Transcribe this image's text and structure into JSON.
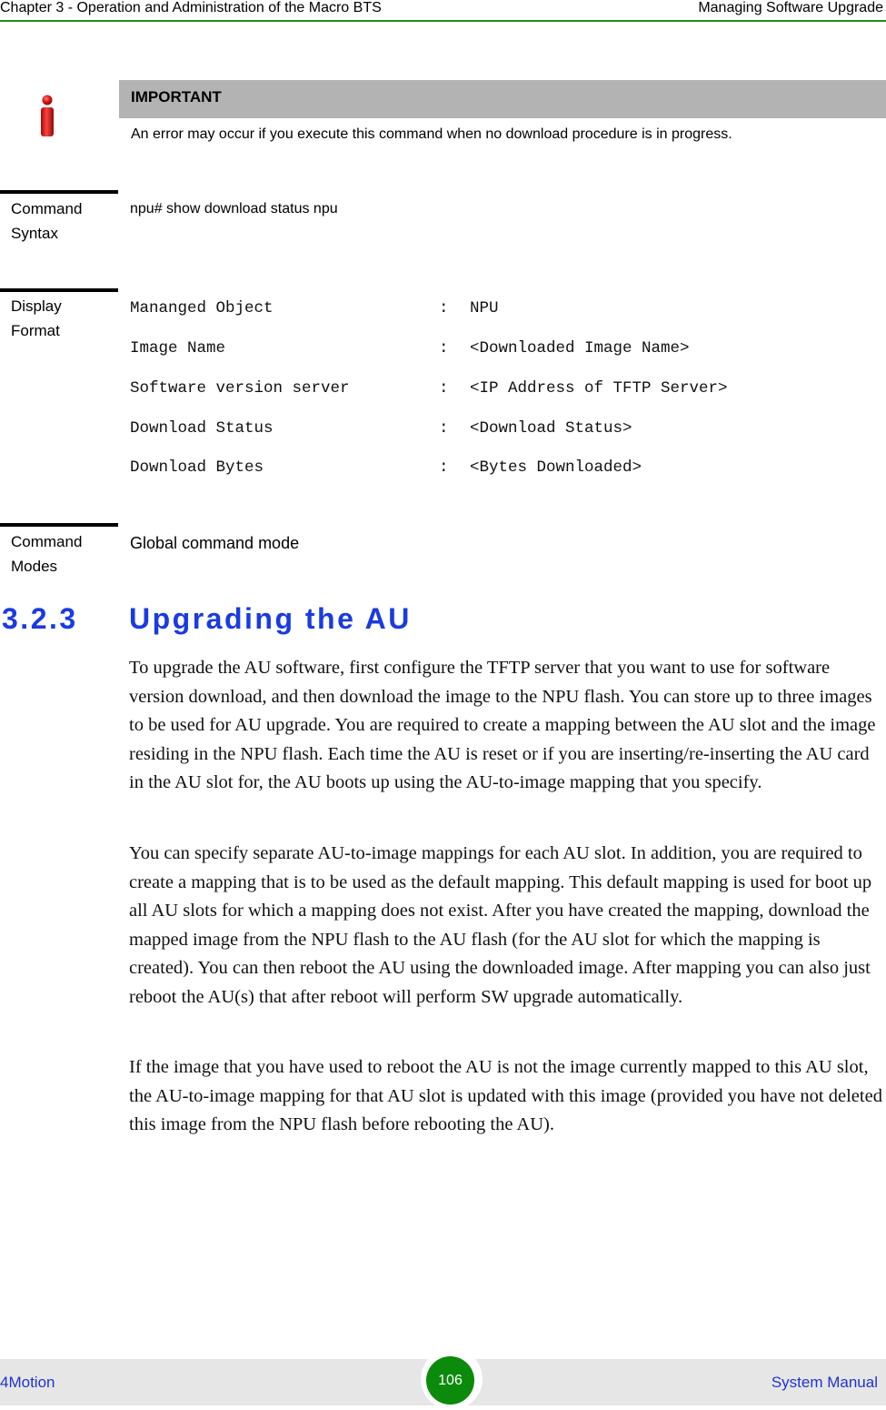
{
  "header": {
    "chapter": "Chapter 3 - Operation and Administration of the Macro BTS",
    "section": "Managing Software Upgrade"
  },
  "important": {
    "icon": "info-icon",
    "title": "IMPORTANT",
    "text": "An error may occur if you execute this command when no download procedure is in progress."
  },
  "command_syntax": {
    "label_line1": "Command",
    "label_line2": "Syntax",
    "value": "npu# show download status npu"
  },
  "display_format": {
    "label_line1": "Display",
    "label_line2": "Format",
    "rows": [
      {
        "key": "Mananged Object",
        "sep": ":",
        "value": "NPU"
      },
      {
        "key": "Image Name",
        "sep": ":",
        "value": "<Downloaded Image Name>"
      },
      {
        "key": "Software version server",
        "sep": ":",
        "value": "<IP Address of TFTP Server>"
      },
      {
        "key": "Download Status",
        "sep": ":",
        "value": "<Download Status>"
      },
      {
        "key": "Download Bytes",
        "sep": ":",
        "value": "<Bytes Downloaded>"
      }
    ]
  },
  "command_modes": {
    "label_line1": "Command",
    "label_line2": "Modes",
    "value": "Global command mode"
  },
  "section": {
    "number": "3.2.3",
    "title": "Upgrading the AU"
  },
  "paragraphs": [
    "To upgrade the AU software, first configure the TFTP server that you want to use for software version download, and then download the image to the NPU flash. You can store up to three images to be used for AU upgrade. You are required to create a mapping between the AU slot and the image residing in the NPU flash. Each time the AU is reset or if you are inserting/re-inserting the AU card in the AU slot for, the AU boots up using the AU-to-image mapping that you specify.",
    "You can specify separate AU-to-image mappings for each AU slot. In addition, you are required to create a mapping that is to be used as the default mapping. This default mapping is used for boot up all AU slots for which a mapping does not exist. After you have created the mapping, download the mapped image from the NPU flash to the AU flash (for the AU slot for which the mapping is created). You can then reboot the AU using the downloaded image. After mapping you can also just reboot the AU(s) that after reboot will perform SW upgrade automatically.",
    "If the image that you have used to reboot the AU is not the image currently mapped to this AU slot, the AU-to-image mapping for that AU slot is updated with this image (provided you have not deleted this image from the NPU flash before rebooting the AU)."
  ],
  "footer": {
    "product": "4Motion",
    "page_number": "106",
    "document": "System Manual"
  },
  "colors": {
    "header_rule": "#1e8c1e",
    "heading_blue": "#1a3be0",
    "footer_link_blue": "#2233cc",
    "page_badge_green": "#0b8a0b",
    "important_bar": "#b3b3b3",
    "footer_bg": "#e6e6e6"
  }
}
